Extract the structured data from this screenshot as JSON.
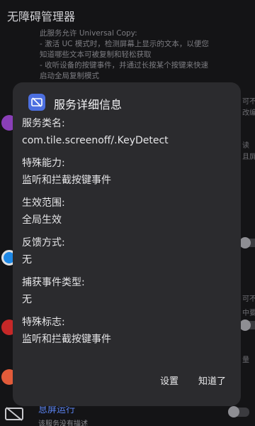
{
  "app": {
    "title": "无障碍管理器"
  },
  "background": {
    "description_lines": [
      "此服务允许 Universal Copy:",
      "- 激活 UC 模式时，检测屏幕上显示的文本，以便您",
      "知道哪些文本可被复制和轻松获取",
      "- 收听设备的按键事件，并通过长按某个按键来快速",
      "启动全局复制模式"
    ],
    "edge_text": [
      "可不",
      "改编",
      "读",
      "且屏",
      "可不",
      "中要",
      "量"
    ],
    "bottom_item": {
      "title": "息屏运行",
      "subtitle": "该服务没有描述"
    }
  },
  "dialog": {
    "title": "服务详细信息",
    "icon": "screen-off-icon",
    "fields": [
      {
        "label": "服务类名:",
        "value": "com.tile.screenoff/.KeyDetect"
      },
      {
        "label": "特殊能力:",
        "value": "监听和拦截按键事件"
      },
      {
        "label": "生效范围:",
        "value": "全局生效"
      },
      {
        "label": "反馈方式:",
        "value": "无"
      },
      {
        "label": "捕获事件类型:",
        "value": "无"
      },
      {
        "label": "特殊标志:",
        "value": "监听和拦截按键事件"
      }
    ],
    "buttons": {
      "settings": "设置",
      "ok": "知道了"
    }
  },
  "colors": {
    "background": "#141416",
    "dialog": "#2b2b2e",
    "accent": "#4c6fe0",
    "link": "#5a82ee"
  }
}
